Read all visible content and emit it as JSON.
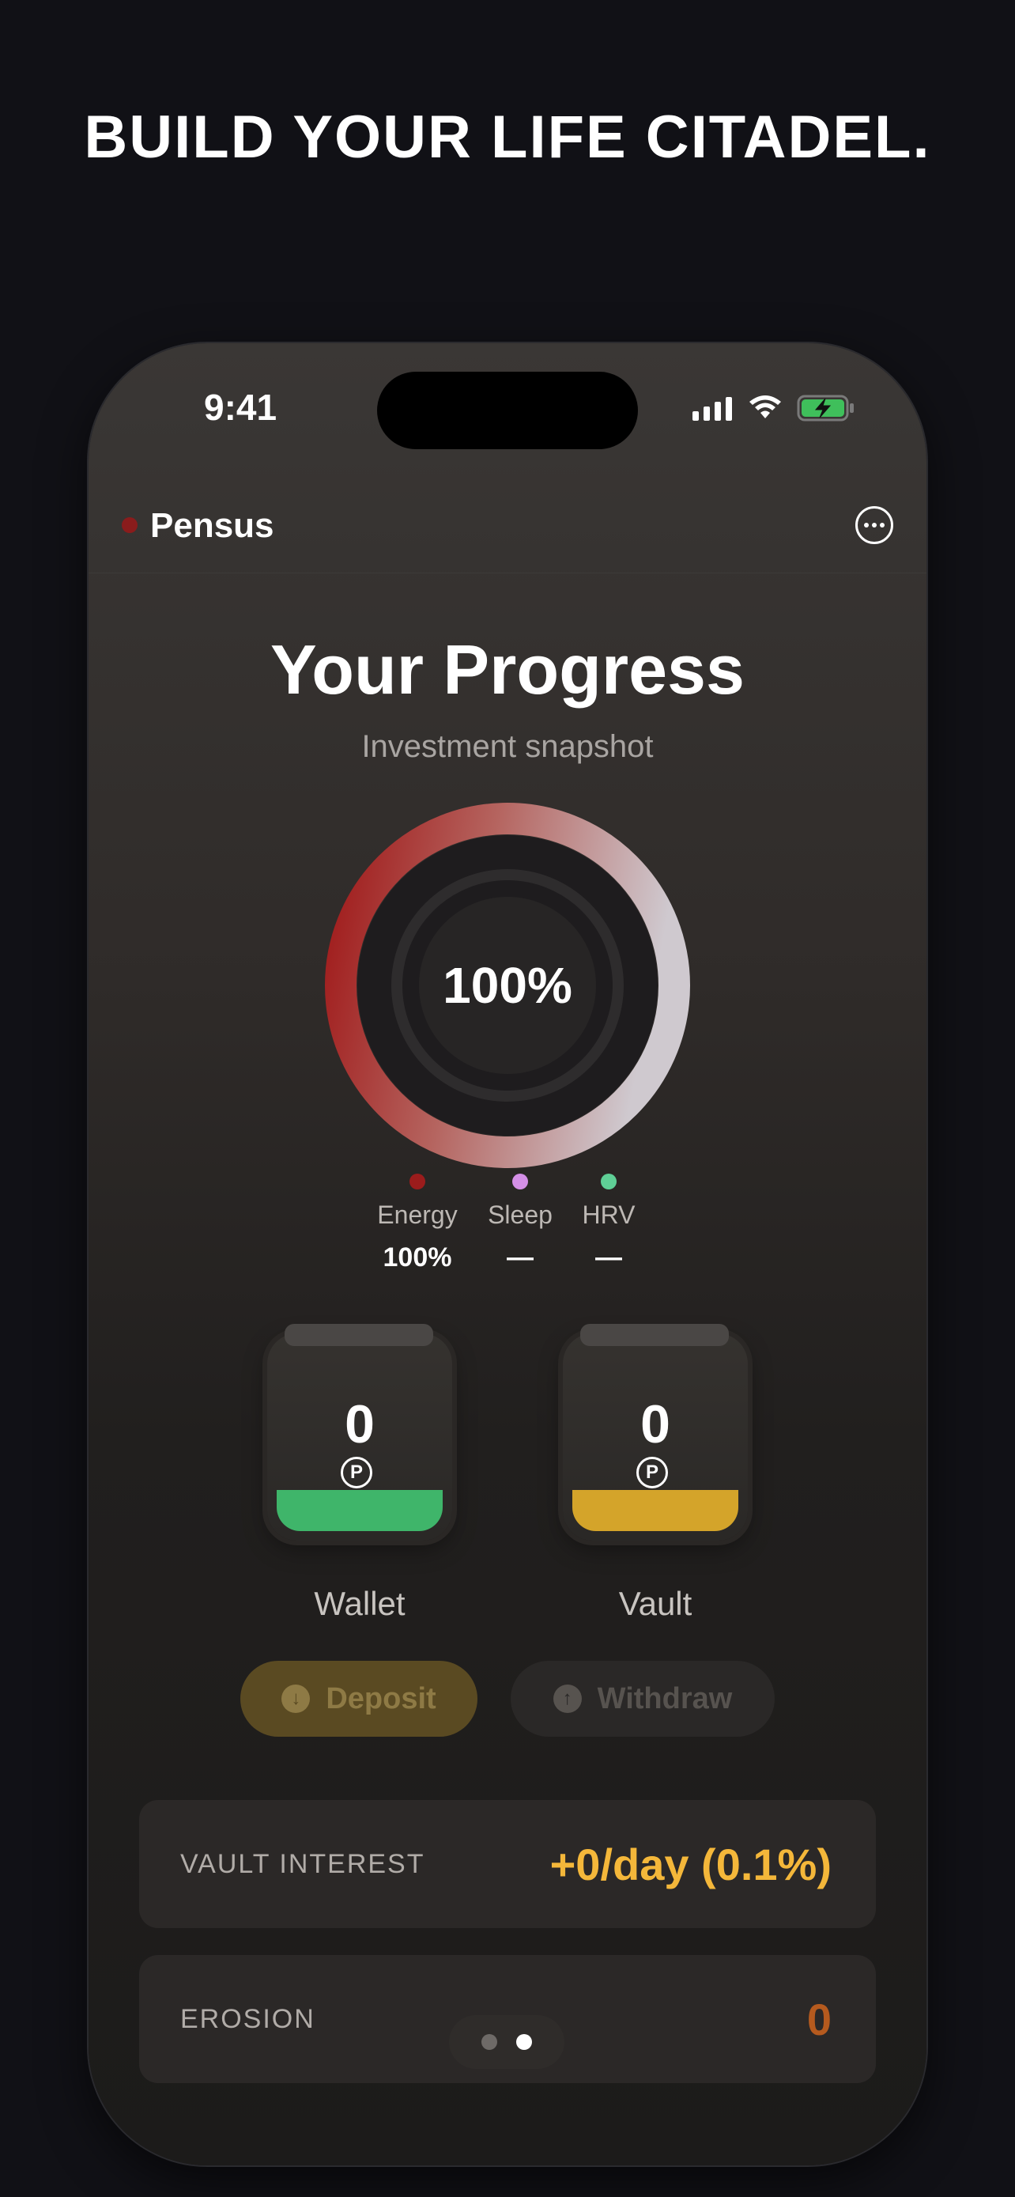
{
  "headline": "BUILD YOUR LIFE CITADEL.",
  "status_bar": {
    "time": "9:41",
    "icons": [
      "signal-icon",
      "wifi-icon",
      "battery-charging-icon"
    ]
  },
  "app": {
    "name": "Pensus",
    "menu_icon": "more-icon",
    "brand_dot_color": "#8a1c1c"
  },
  "progress": {
    "title": "Your Progress",
    "subtitle": "Investment snapshot",
    "ring_percent_label": "100%",
    "ring_fraction": 1.0
  },
  "legend": [
    {
      "name": "Energy",
      "value": "100%",
      "color": "#9b1c1c"
    },
    {
      "name": "Sleep",
      "value": "—",
      "color": "#d48fe6"
    },
    {
      "name": "HRV",
      "value": "—",
      "color": "#5fcf96"
    }
  ],
  "jars": [
    {
      "label": "Wallet",
      "amount": "0",
      "coin": "P",
      "color": "#3fb56a"
    },
    {
      "label": "Vault",
      "amount": "0",
      "coin": "P",
      "color": "#d4a42a"
    }
  ],
  "actions": {
    "deposit_label": "Deposit",
    "withdraw_label": "Withdraw"
  },
  "cards": {
    "vault_interest_label": "VAULT INTEREST",
    "vault_interest_value": "+0/day (0.1%)",
    "vault_interest_color": "#f4b73a",
    "erosion_label": "EROSION",
    "erosion_value": "0",
    "erosion_color": "#b55a1e"
  },
  "pager": {
    "pages": 2,
    "active": 2
  }
}
